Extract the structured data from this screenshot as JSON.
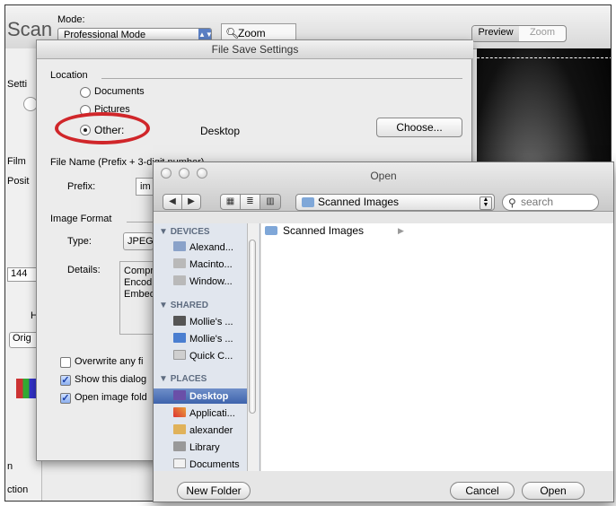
{
  "background_app": {
    "app_title": "Scan",
    "mode_label": "Mode:",
    "mode_value": "Professional Mode",
    "zoom_tool_label": "Zoom",
    "preview_tab": "Preview",
    "zoom_tab": "Zoom",
    "side_fragments": [
      "Setti",
      "Film",
      "Posit",
      "144",
      "H",
      "Orig",
      "n",
      "ction"
    ]
  },
  "file_save_settings": {
    "title": "File Save Settings",
    "location_label": "Location",
    "radio_documents": "Documents",
    "radio_pictures": "Pictures",
    "radio_other": "Other:",
    "other_location": "Desktop",
    "choose_button": "Choose...",
    "filename_label": "File Name (Prefix + 3-digit number)",
    "prefix_label": "Prefix:",
    "prefix_value": "im",
    "image_format_label": "Image Format",
    "type_label": "Type:",
    "type_value": "JPEG",
    "details_label": "Details:",
    "details_lines": [
      "Compr",
      "Encod",
      "Embed"
    ],
    "overwrite_label": "Overwrite any fi",
    "show_dialog_label": "Show this dialog",
    "open_folder_label": "Open image fold"
  },
  "open_dialog": {
    "title": "Open",
    "path_value": "Scanned Images",
    "search_placeholder": "search",
    "sidebar": {
      "devices_header": "DEVICES",
      "devices": [
        "Alexand...",
        "Macinto...",
        "Window..."
      ],
      "shared_header": "SHARED",
      "shared": [
        "Mollie's ...",
        "Mollie's ...",
        "Quick C..."
      ],
      "places_header": "PLACES",
      "places": [
        "Desktop",
        "Applicati...",
        "alexander",
        "Library",
        "Documents"
      ]
    },
    "column1_items": [
      "Scanned Images"
    ],
    "new_folder_button": "New Folder",
    "cancel_button": "Cancel",
    "open_button": "Open"
  },
  "colors": {
    "highlight_circle": "#d0262a",
    "sidebar_selection": "#3e63ac",
    "sidebar_background": "#e1e6ee"
  }
}
